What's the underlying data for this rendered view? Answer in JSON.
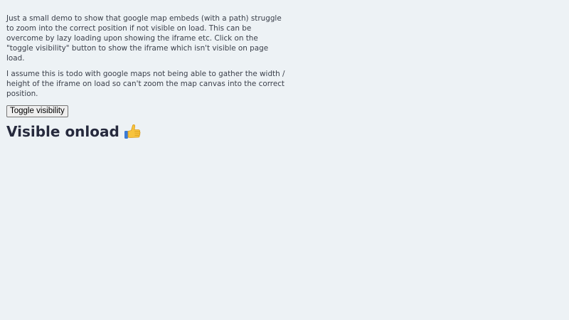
{
  "intro": {
    "paragraph_1": "Just a small demo to show that google map embeds (with a path) struggle to zoom into the correct position if not visible on load. This can be overcome by lazy loading upon showing the iframe etc. Click on the \"toggle visibility\" button to show the iframe which isn't visible on page load.",
    "paragraph_2": "I assume this is todo with google maps not being able to gather the width / height of the iframe on load so can't zoom the map canvas into the correct position."
  },
  "controls": {
    "toggle_label": "Toggle visibility"
  },
  "section": {
    "heading": "Visible onload",
    "heading_icon": "thumbs-up-icon"
  },
  "colors": {
    "background": "#edf2f5",
    "text": "#3a3f4a",
    "heading": "#262a3d",
    "thumb": "#f7c33c"
  }
}
